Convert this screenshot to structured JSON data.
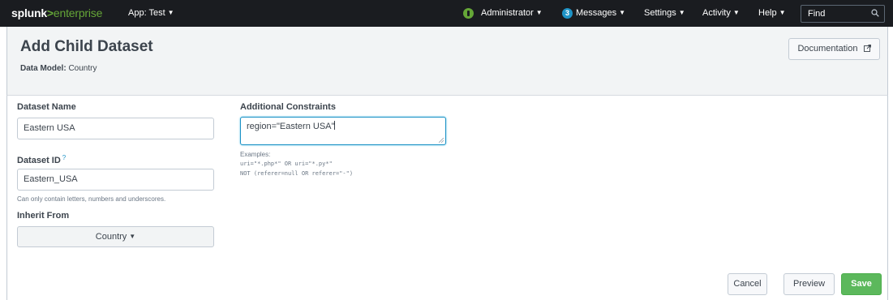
{
  "topbar": {
    "brand_splunk": "splunk",
    "brand_gt": ">",
    "brand_enterprise": "enterprise",
    "app_menu": "App: Test",
    "user_menu": "Administrator",
    "messages_count": "3",
    "messages_menu": "Messages",
    "settings_menu": "Settings",
    "activity_menu": "Activity",
    "help_menu": "Help",
    "find_label": "Find"
  },
  "header": {
    "title": "Add Child Dataset",
    "model_label": "Data Model:",
    "model_value": "Country",
    "documentation_button": "Documentation"
  },
  "form": {
    "dataset_name_label": "Dataset Name",
    "dataset_name_value": "Eastern USA",
    "dataset_id_label": "Dataset ID",
    "dataset_id_help_mark": "?",
    "dataset_id_value": "Eastern_USA",
    "dataset_id_help": "Can only contain letters, numbers and underscores.",
    "inherit_from_label": "Inherit From",
    "inherit_from_value": "Country",
    "constraints_label": "Additional Constraints",
    "constraints_value": "region=\"Eastern USA\"",
    "examples_label": "Examples:",
    "examples": [
      "uri=\"*.php*\" OR uri=\"*.py*\"",
      "NOT (referer=null OR referer=\"-\")"
    ]
  },
  "actions": {
    "cancel": "Cancel",
    "preview": "Preview",
    "save": "Save"
  },
  "colors": {
    "topbar_bg": "#1a1c20",
    "brand_accent": "#65a637",
    "messages_badge": "#1e93c6",
    "save_button": "#5cb85c",
    "header_bg": "#f2f4f5"
  },
  "icons": {
    "status": "status-alert-icon",
    "find": "search-icon",
    "documentation": "external-link-icon",
    "dropdown": "caret-down-icon"
  }
}
